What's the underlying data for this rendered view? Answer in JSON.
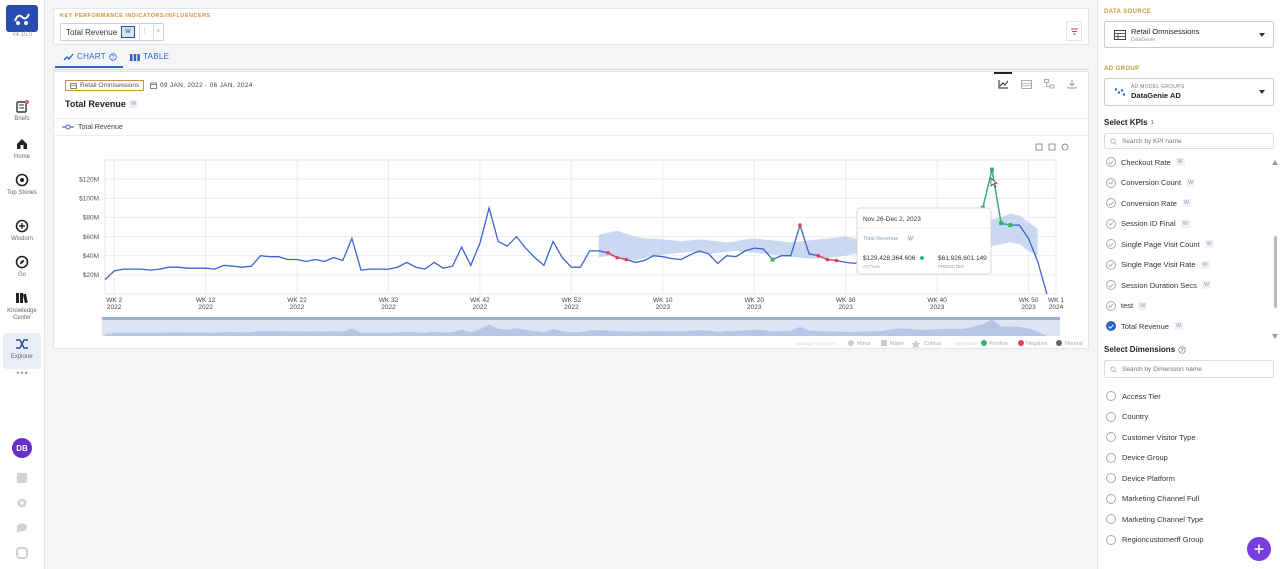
{
  "app": {
    "version": "v4.15.0"
  },
  "nav": {
    "items": [
      {
        "label": "Briefs",
        "icon": "briefs-icon"
      },
      {
        "label": "Home",
        "icon": "home-icon"
      },
      {
        "label": "Top Stories",
        "icon": "top-stories-icon"
      },
      {
        "label": "Wisdom",
        "icon": "wisdom-icon"
      },
      {
        "label": "Go",
        "icon": "compass-icon"
      },
      {
        "label": "Knowledge Center",
        "icon": "knowledge-icon"
      },
      {
        "label": "Explorer",
        "icon": "explorer-icon"
      }
    ],
    "more": "•••",
    "avatar": "DB"
  },
  "kpi_bar": {
    "label": "KEY PERFORMANCE INDICATORS/INFLUENCERS",
    "chip_label": "Total Revenue",
    "chip_badge": "W"
  },
  "tabs": [
    {
      "label": "CHART",
      "active": true
    },
    {
      "label": "TABLE",
      "active": false
    }
  ],
  "chart_panel": {
    "source": "Retail Omnisessions",
    "date_range": "09 JAN, 2022 - 06 JAN, 2024",
    "title": "Total Revenue",
    "title_badge": "W",
    "legend_series": "Total Revenue"
  },
  "chart_data": {
    "type": "line",
    "title": "Total Revenue",
    "xlabel": "",
    "ylabel": "",
    "y_tick_labels": [
      "$20M",
      "$40M",
      "$60M",
      "$80M",
      "$100M",
      "$120M"
    ],
    "y_ticks": [
      20,
      40,
      60,
      80,
      100,
      120
    ],
    "ylim": [
      0,
      140
    ],
    "x_tick_labels": [
      {
        "week": 2,
        "label": "WK 2",
        "year": "2022"
      },
      {
        "week": 12,
        "label": "WK 12",
        "year": "2022"
      },
      {
        "week": 22,
        "label": "WK 22",
        "year": "2022"
      },
      {
        "week": 32,
        "label": "WK 32",
        "year": "2022"
      },
      {
        "week": 42,
        "label": "WK 42",
        "year": "2022"
      },
      {
        "week": 52,
        "label": "WK 52",
        "year": "2022"
      },
      {
        "week": 62,
        "label": "WK 10",
        "year": "2023"
      },
      {
        "week": 72,
        "label": "WK 20",
        "year": "2023"
      },
      {
        "week": 82,
        "label": "WK 30",
        "year": "2023"
      },
      {
        "week": 92,
        "label": "WK 40",
        "year": "2023"
      },
      {
        "week": 102,
        "label": "WK 50",
        "year": "2023"
      },
      {
        "week": 105,
        "label": "WK 1",
        "year": "2024"
      }
    ],
    "x_range": [
      1,
      105
    ],
    "grid": true,
    "series": [
      {
        "name": "Total Revenue",
        "color": "#3d63d1",
        "values": [
          15,
          24,
          26,
          26,
          26,
          25,
          26,
          28,
          28,
          27,
          27,
          27,
          26,
          30,
          29,
          28,
          29,
          40,
          39,
          39,
          36,
          36,
          34,
          36,
          34,
          38,
          35,
          58,
          25,
          26,
          26,
          26,
          28,
          33,
          28,
          26,
          33,
          27,
          29,
          49,
          30,
          53,
          90,
          55,
          50,
          60,
          48,
          38,
          30,
          55,
          38,
          28,
          28,
          45,
          45,
          43,
          38,
          36,
          33,
          35,
          40,
          39,
          37,
          36,
          41,
          45,
          42,
          32,
          40,
          39,
          45,
          48,
          47,
          36,
          40,
          40,
          72,
          42,
          40,
          36,
          35,
          33,
          32,
          35,
          37,
          40,
          52,
          58,
          55,
          49,
          48,
          51,
          55,
          54,
          56,
          75,
          90,
          130,
          74,
          72,
          72,
          58,
          34,
          0
        ]
      }
    ],
    "band_range": [
      55,
      103
    ],
    "band_low": [
      38,
      40,
      38,
      36,
      35,
      38,
      40,
      41,
      42,
      43,
      44,
      43,
      42,
      43,
      44,
      45,
      44,
      43,
      42,
      41,
      40,
      39,
      38,
      37,
      37,
      38,
      39,
      40,
      42,
      43,
      44,
      45,
      44,
      43,
      44,
      45,
      44,
      43,
      42,
      41,
      40,
      44,
      48,
      50,
      52,
      54,
      52,
      45,
      40
    ],
    "band_high": [
      62,
      64,
      66,
      63,
      60,
      58,
      58,
      57,
      56,
      55,
      56,
      57,
      56,
      55,
      54,
      55,
      57,
      58,
      57,
      56,
      55,
      54,
      55,
      56,
      57,
      58,
      59,
      60,
      58,
      57,
      56,
      55,
      56,
      57,
      58,
      60,
      62,
      63,
      64,
      65,
      66,
      70,
      74,
      78,
      80,
      84,
      82,
      75,
      68
    ],
    "anomalies": {
      "negative": [
        56,
        57,
        58,
        77,
        79,
        80,
        81
      ],
      "positive": [
        74,
        93,
        97,
        98,
        99,
        100
      ]
    },
    "tooltip": {
      "title": "Nov 26-Dec 2, 2023",
      "series": "Total Revenue",
      "actual": "$129,428,364.606",
      "actual_label": "ACTUAL",
      "predicted": "$61,926,601.149",
      "predicted_label": "PREDICTED"
    },
    "footer": {
      "severity_label": "ANOMALY SEVERITY",
      "severity": [
        "Minor",
        "Major",
        "Critical"
      ],
      "sentiment_label": "SENTIMENT",
      "sentiment": [
        "Positive",
        "Negative",
        "Neutral"
      ]
    }
  },
  "right_panel": {
    "data_source_label": "DATA SOURCE",
    "data_source": "Retail Omnisessions",
    "data_source_sub": "DataGenie",
    "ad_group_label": "AD GROUP",
    "ad_group_small": "AD MODEL GROUPS",
    "ad_group": "DataGenie AD",
    "select_kpis": "Select KPIs",
    "select_kpis_count": "1",
    "kpi_search_placeholder": "Search by KPI name",
    "kpis": [
      {
        "label": "Checkout Rate",
        "checked": false
      },
      {
        "label": "Conversion Count",
        "checked": false
      },
      {
        "label": "Conversion Rate",
        "checked": false
      },
      {
        "label": "Session ID Final",
        "checked": false
      },
      {
        "label": "Single Page Visit Count",
        "checked": false
      },
      {
        "label": "Single Page Visit Rate",
        "checked": false
      },
      {
        "label": "Session Duration Secs",
        "checked": false
      },
      {
        "label": "test",
        "checked": false
      },
      {
        "label": "Total Revenue",
        "checked": true
      }
    ],
    "kpi_badge": "W",
    "select_dimensions": "Select Dimensions",
    "dimension_search_placeholder": "Search by Dimension name",
    "dimensions": [
      "Access Tier",
      "Country",
      "Customer Visitor Type",
      "Device Group",
      "Device Platform",
      "Marketing Channel Full",
      "Marketing Channel Type",
      "Regioncustomerff Group"
    ]
  },
  "colors": {
    "primary": "#2a64c9",
    "accent": "#c7963b",
    "positive": "#35b36b",
    "negative": "#e0405a",
    "band": "#b9cbec",
    "fab": "#7a3ee0"
  }
}
